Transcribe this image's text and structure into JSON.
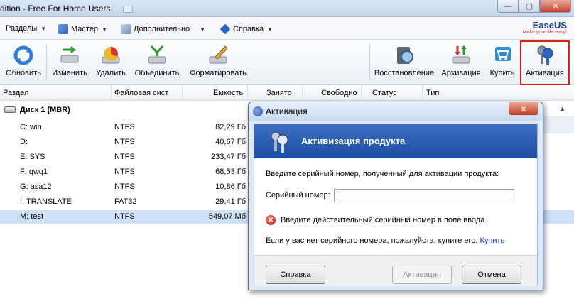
{
  "window": {
    "title": "dition - Free For Home Users",
    "min": "—",
    "max": "▢",
    "close": "✕"
  },
  "menu": {
    "items": [
      {
        "label": "Разделы",
        "icon": "partition-icon"
      },
      {
        "label": "Мастер",
        "icon": "wizard-icon"
      },
      {
        "label": "Дополнительно",
        "icon": "advanced-icon"
      },
      {
        "label": "Справка",
        "icon": "help-icon"
      }
    ]
  },
  "logo": {
    "brand": "EaseUS",
    "tagline": "Make your life easy!"
  },
  "toolbar": {
    "refresh": "Обновить",
    "resize": "Изменить",
    "delete": "Удалить",
    "merge": "Объединить",
    "format": "Форматировать",
    "recovery": "Восстановление",
    "archive": "Архивация",
    "buy": "Купить",
    "activate": "Активация"
  },
  "columns": [
    "Раздел",
    "Файловая сист",
    "Емкость",
    "Занято",
    "Свободно",
    "Статус",
    "Тип"
  ],
  "disk": {
    "label": "Диск 1 (MBR)"
  },
  "partitions": [
    {
      "name": "C: win",
      "fs": "NTFS",
      "cap": "82,29 Гб"
    },
    {
      "name": "D:",
      "fs": "NTFS",
      "cap": "40,67 Гб"
    },
    {
      "name": "E: SYS",
      "fs": "NTFS",
      "cap": "233,47 Гб"
    },
    {
      "name": "F: qwq1",
      "fs": "NTFS",
      "cap": "68,53 Гб"
    },
    {
      "name": "G: asa12",
      "fs": "NTFS",
      "cap": "10,86 Гб"
    },
    {
      "name": "I: TRANSLATE",
      "fs": "FAT32",
      "cap": "29,41 Гб"
    },
    {
      "name": "M: test",
      "fs": "NTFS",
      "cap": "549,07 Мб"
    }
  ],
  "dialog": {
    "title": "Активация",
    "close": "x",
    "banner": "Активизация продукта",
    "prompt": "Введите серийный номер, полученный для активации продукта:",
    "serial_label": "Серийный номер:",
    "serial_value": "",
    "error": "Введите действительный серийный номер в поле ввода.",
    "buy_text": "Если у вас нет серийного номера, пожалуйста, купите его.",
    "buy_link": "Купить",
    "help_btn": "Справка",
    "activate_btn": "Активация",
    "cancel_btn": "Отмена"
  }
}
